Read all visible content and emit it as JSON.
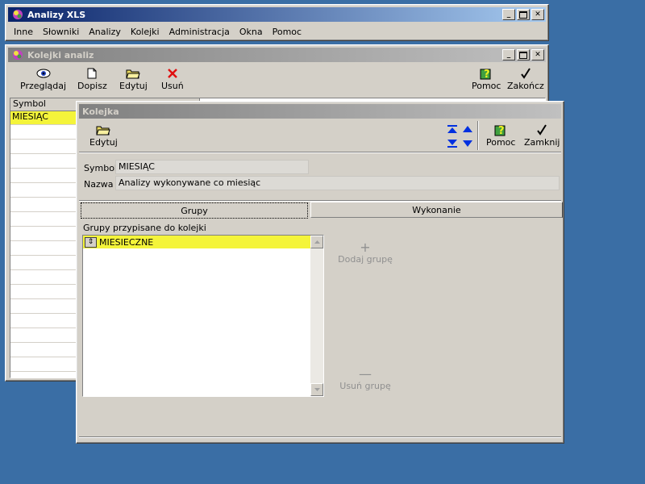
{
  "main_window": {
    "title": "Analizy XLS",
    "menu": [
      "Inne",
      "Słowniki",
      "Analizy",
      "Kolejki",
      "Administracja",
      "Okna",
      "Pomoc"
    ]
  },
  "kolejki_window": {
    "title": "Kolejki analiz",
    "toolbar": {
      "browse": "Przeglądaj",
      "add": "Dopisz",
      "edit": "Edytuj",
      "delete": "Usuń",
      "help": "Pomoc",
      "close": "Zakończ"
    },
    "grid": {
      "col_symbol": "Symbol",
      "rows": [
        "MIESIĄC"
      ]
    }
  },
  "kolejka_dialog": {
    "title": "Kolejka",
    "toolbar": {
      "edit": "Edytuj",
      "help": "Pomoc",
      "close": "Zamknij"
    },
    "symbol_label": "Symbol",
    "symbol_value": "MIESIĄC",
    "nazwa_label": "Nazwa",
    "nazwa_value": "Analizy wykonywane co miesiąc",
    "tabs": [
      "Grupy",
      "Wykonanie"
    ],
    "groups_label": "Grupy przypisane do kolejki",
    "groups": [
      "MIESIECZNE"
    ],
    "add_group": "Dodaj grupę",
    "remove_group": "Usuń grupę"
  },
  "colors": {
    "desktop": "#3a6ea5",
    "highlight": "#f4f43a",
    "title_active": "#0a246a",
    "title_inactive": "#808080"
  }
}
